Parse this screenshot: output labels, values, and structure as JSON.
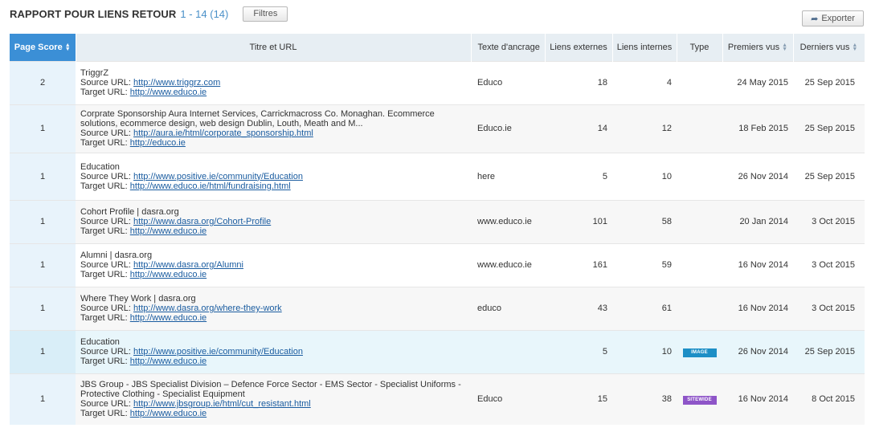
{
  "header": {
    "title": "RAPPORT POUR LIENS RETOUR",
    "range": "1 - 14 (14)",
    "filter_label": "Filtres"
  },
  "export": {
    "label": "Exporter",
    "icon": "share-arrow-icon"
  },
  "columns": [
    "Page Score",
    "Titre et URL",
    "Texte d'ancrage",
    "Liens externes",
    "Liens internes",
    "Type",
    "Premiers vus",
    "Derniers vus"
  ],
  "source_prefix": "Source URL:",
  "target_prefix": "Target URL:",
  "badge_colors": {
    "IMAGE": "#1d8fc6",
    "SITEWIDE": "#8e55c8"
  },
  "rows": [
    {
      "score": "2",
      "title": "TriggrZ",
      "source": "http://www.triggrz.com",
      "target": "http://www.educo.ie",
      "anchor": "Educo",
      "ext": "18",
      "int": "4",
      "type": "",
      "first": "24 May 2015",
      "last": "25 Sep 2015"
    },
    {
      "score": "1",
      "title": "Corprate Sponsorship Aura Internet Services, Carrickmacross Co. Monaghan. Ecommerce solutions, ecommerce design, web design Dublin, Louth, Meath and M...",
      "source": "http://aura.ie/html/corporate_sponsorship.html",
      "target": "http://educo.ie",
      "anchor": "Educo.ie",
      "ext": "14",
      "int": "12",
      "type": "",
      "first": "18 Feb 2015",
      "last": "25 Sep 2015"
    },
    {
      "score": "1",
      "title": "Education",
      "source": "http://www.positive.ie/community/Education",
      "target": "http://www.educo.ie/html/fundraising.html",
      "anchor": "here",
      "ext": "5",
      "int": "10",
      "type": "",
      "first": "26 Nov 2014",
      "last": "25 Sep 2015"
    },
    {
      "score": "1",
      "title": "Cohort Profile | dasra.org",
      "source": "http://www.dasra.org/Cohort-Profile",
      "target": "http://www.educo.ie",
      "anchor": "www.educo.ie",
      "ext": "101",
      "int": "58",
      "type": "",
      "first": "20 Jan 2014",
      "last": "3 Oct 2015"
    },
    {
      "score": "1",
      "title": "Alumni | dasra.org",
      "source": "http://www.dasra.org/Alumni",
      "target": "http://www.educo.ie",
      "anchor": "www.educo.ie",
      "ext": "161",
      "int": "59",
      "type": "",
      "first": "16 Nov 2014",
      "last": "3 Oct 2015"
    },
    {
      "score": "1",
      "title": "Where They Work | dasra.org",
      "source": "http://www.dasra.org/where-they-work",
      "target": "http://www.educo.ie",
      "anchor": "educo",
      "ext": "43",
      "int": "61",
      "type": "",
      "first": "16 Nov 2014",
      "last": "3 Oct 2015"
    },
    {
      "score": "1",
      "title": "Education",
      "source": "http://www.positive.ie/community/Education",
      "target": "http://www.educo.ie",
      "anchor": "",
      "ext": "5",
      "int": "10",
      "type": "IMAGE",
      "first": "26 Nov 2014",
      "last": "25 Sep 2015"
    },
    {
      "score": "1",
      "title": "JBS Group - JBS Specialist Division – Defence Force Sector - EMS Sector - Specialist Uniforms - Protective Clothing - Specialist Equipment",
      "source": "http://www.jbsgroup.ie/html/cut_resistant.html",
      "target": "http://www.educo.ie",
      "anchor": "Educo",
      "ext": "15",
      "int": "38",
      "type": "SITEWIDE",
      "first": "16 Nov 2014",
      "last": "8 Oct 2015"
    }
  ]
}
